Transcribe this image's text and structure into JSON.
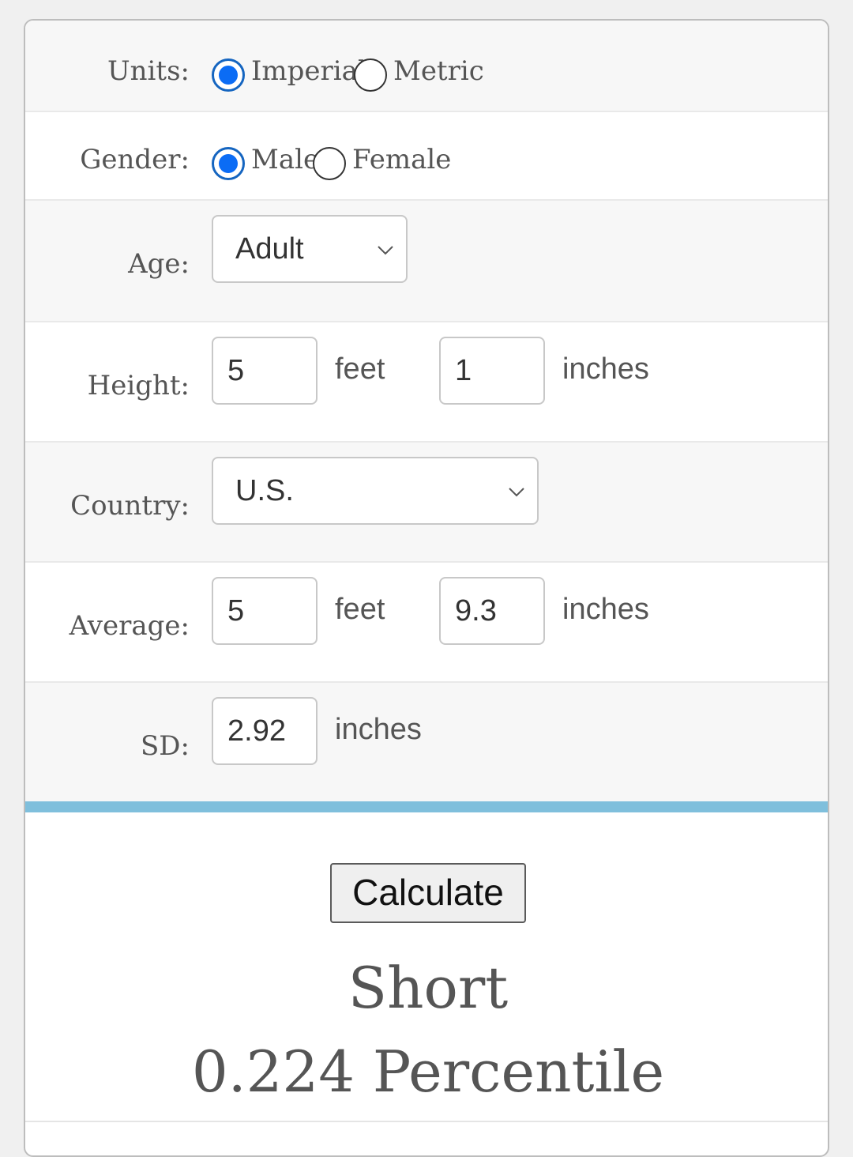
{
  "form": {
    "units": {
      "label": "Units:",
      "options": [
        {
          "label": "Imperial",
          "checked": true
        },
        {
          "label": "Metric",
          "checked": false
        }
      ]
    },
    "gender": {
      "label": "Gender:",
      "options": [
        {
          "label": "Male",
          "checked": true
        },
        {
          "label": "Female",
          "checked": false
        }
      ]
    },
    "age": {
      "label": "Age:",
      "selected": "Adult"
    },
    "height": {
      "label": "Height:",
      "feet_value": "5",
      "feet_unit": "feet",
      "inches_value": "1",
      "inches_unit": "inches"
    },
    "country": {
      "label": "Country:",
      "selected": "U.S."
    },
    "average": {
      "label": "Average:",
      "feet_value": "5",
      "feet_unit": "feet",
      "inches_value": "9.3",
      "inches_unit": "inches"
    },
    "sd": {
      "label": "SD:",
      "value": "2.92",
      "unit": "inches"
    }
  },
  "calculate_label": "Calculate",
  "result": {
    "category": "Short",
    "percentile": "0.224 Percentile"
  },
  "colors": {
    "accent_bar": "#7fbfdc",
    "radio_checked": "#0b6cf5"
  }
}
